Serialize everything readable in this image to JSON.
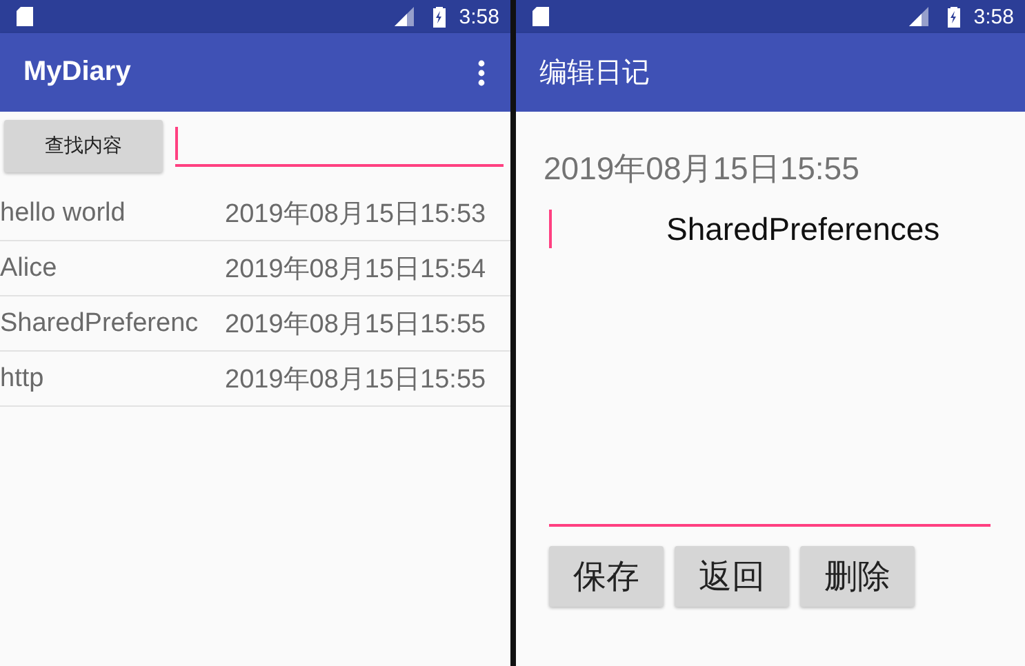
{
  "screens": [
    {
      "status_bar": {
        "time": "3:58"
      },
      "app_bar": {
        "title": "MyDiary",
        "has_menu": true
      },
      "search": {
        "button": "查找内容",
        "field": {
          "focused": true
        }
      },
      "diary_list": [
        {
          "title": "hello world",
          "date": "2019年08月15日15:53"
        },
        {
          "title": "Alice",
          "date": "2019年08月15日15:54"
        },
        {
          "title": "SharedPreferenc",
          "date": "2019年08月15日15:55"
        },
        {
          "title": "http",
          "date": "2019年08月15日15:55"
        }
      ]
    },
    {
      "status_bar": {
        "time": "3:58"
      },
      "app_bar": {
        "title": "编辑日记",
        "has_menu": false
      },
      "editor": {
        "date": "2019年08月15日15:55",
        "field": {
          "value": "SharedPreferences",
          "focused": true
        },
        "buttons": [
          "保存",
          "返回",
          "删除"
        ]
      }
    }
  ]
}
